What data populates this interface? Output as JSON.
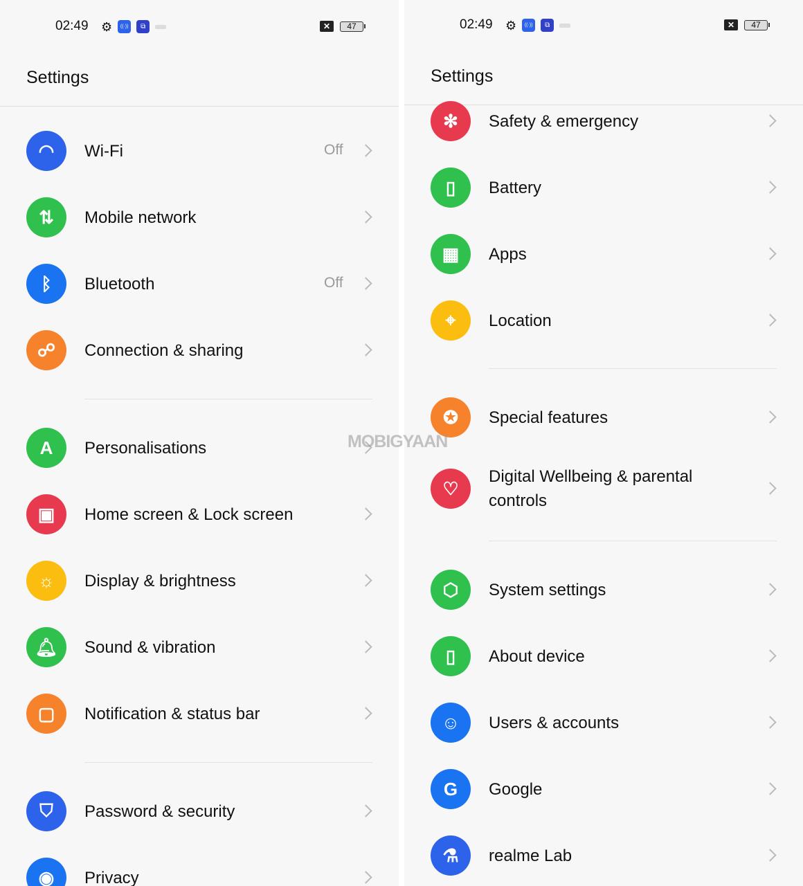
{
  "status_bar": {
    "time": "02:49",
    "battery": "47"
  },
  "colors": {
    "blue": "#2d62ea",
    "green": "#2fc04e",
    "orange": "#f7822c",
    "red": "#e83a4e",
    "yellow": "#fbbd10",
    "brightblue": "#1a73f0"
  },
  "watermark": "MOBIGYAAN",
  "left": {
    "title": "Settings",
    "items": [
      {
        "label": "Wi-Fi",
        "value": "Off",
        "icon": "wifi-icon",
        "color": "blue"
      },
      {
        "label": "Mobile network",
        "icon": "mobile-data-icon",
        "color": "green"
      },
      {
        "label": "Bluetooth",
        "value": "Off",
        "icon": "bluetooth-icon",
        "color": "brightblue"
      },
      {
        "label": "Connection & sharing",
        "icon": "connection-icon",
        "color": "orange"
      },
      {
        "label": "Personalisations",
        "icon": "compass-icon",
        "color": "green"
      },
      {
        "label": "Home screen & Lock screen",
        "icon": "image-icon",
        "color": "red"
      },
      {
        "label": "Display & brightness",
        "icon": "sun-icon",
        "color": "yellow"
      },
      {
        "label": "Sound & vibration",
        "icon": "bell-icon",
        "color": "green"
      },
      {
        "label": "Notification & status bar",
        "icon": "notification-icon",
        "color": "orange"
      },
      {
        "label": "Password & security",
        "icon": "shield-icon",
        "color": "blue"
      },
      {
        "label": "Privacy",
        "icon": "eye-icon",
        "color": "brightblue"
      }
    ]
  },
  "right": {
    "title": "Settings",
    "items": [
      {
        "label": "Safety & emergency",
        "icon": "asterisk-icon",
        "color": "red"
      },
      {
        "label": "Battery",
        "icon": "battery-icon",
        "color": "green"
      },
      {
        "label": "Apps",
        "icon": "apps-grid-icon",
        "color": "green"
      },
      {
        "label": "Location",
        "icon": "location-icon",
        "color": "yellow"
      },
      {
        "label": "Special features",
        "icon": "star-icon",
        "color": "orange"
      },
      {
        "label": "Digital Wellbeing & parental controls",
        "icon": "heart-person-icon",
        "color": "red"
      },
      {
        "label": "System settings",
        "icon": "hexagon-icon",
        "color": "green"
      },
      {
        "label": "About device",
        "icon": "phone-icon",
        "color": "green"
      },
      {
        "label": "Users & accounts",
        "icon": "user-icon",
        "color": "brightblue"
      },
      {
        "label": "Google",
        "icon": "google-icon",
        "color": "brightblue"
      },
      {
        "label": "realme Lab",
        "icon": "flask-icon",
        "color": "blue"
      }
    ]
  }
}
